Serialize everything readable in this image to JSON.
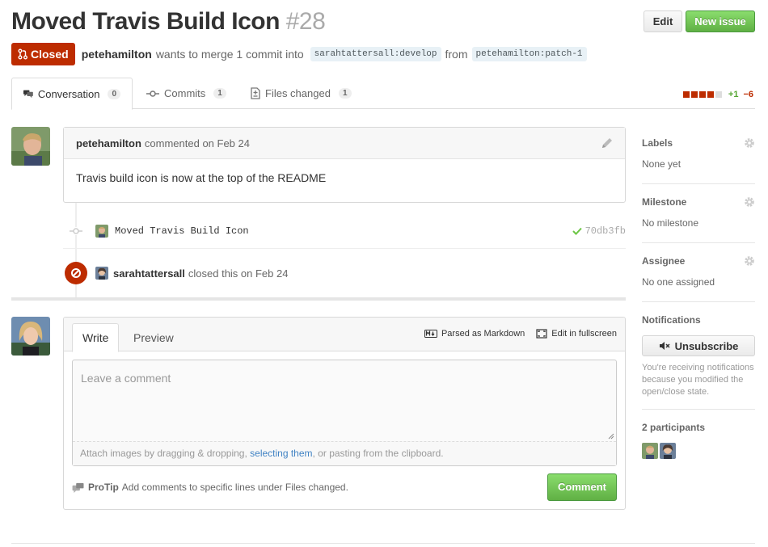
{
  "header": {
    "title": "Moved Travis Build Icon",
    "number": "#28",
    "edit_label": "Edit",
    "new_issue_label": "New issue"
  },
  "meta": {
    "state_label": "Closed",
    "author": "petehamilton",
    "text_wants": "wants to merge 1 commit into",
    "base_branch": "sarahtattersall:develop",
    "text_from": "from",
    "head_branch": "petehamilton:patch-1"
  },
  "tabs": [
    {
      "label": "Conversation",
      "count": "0"
    },
    {
      "label": "Commits",
      "count": "1"
    },
    {
      "label": "Files changed",
      "count": "1"
    }
  ],
  "diffstat": {
    "additions": "+1",
    "deletions": "−6",
    "colors": {
      "add": "#55a532",
      "del": "#bd2c00",
      "neutral": "#ddd"
    }
  },
  "comment": {
    "author": "petehamilton",
    "action": "commented on Feb 24",
    "body": "Travis build icon is now at the top of the README"
  },
  "commit": {
    "message": "Moved Travis Build Icon",
    "sha": "70db3fb"
  },
  "close_event": {
    "actor": "sarahtattersall",
    "text": "closed this on Feb 24"
  },
  "new_comment": {
    "tab_write": "Write",
    "tab_preview": "Preview",
    "tool_markdown": "Parsed as Markdown",
    "tool_fullscreen": "Edit in fullscreen",
    "placeholder": "Leave a comment",
    "drop_prefix": "Attach images by dragging & dropping, ",
    "drop_link": "selecting them",
    "drop_suffix": ", or pasting from the clipboard.",
    "protip_bold": "ProTip",
    "protip_text": "Add comments to specific lines under Files changed.",
    "submit_label": "Comment"
  },
  "sidebar": {
    "labels_head": "Labels",
    "labels_val": "None yet",
    "milestone_head": "Milestone",
    "milestone_val": "No milestone",
    "assignee_head": "Assignee",
    "assignee_val": "No one assigned",
    "notifications_head": "Notifications",
    "unsubscribe_label": "Unsubscribe",
    "notification_note": "You're receiving notifications because you modified the open/close state.",
    "participants_head": "2 participants"
  },
  "colors": {
    "closed": "#bd2c00",
    "green_button": "#60b044",
    "link": "#4183c4"
  }
}
